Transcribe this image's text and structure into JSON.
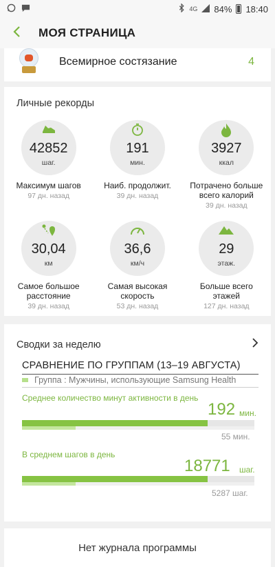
{
  "status": {
    "signal": "4G",
    "battery": "84%",
    "time": "18:40"
  },
  "appbar": {
    "title": "МОЯ СТРАНИЦА"
  },
  "top_item": {
    "label": "Всемирное состязание",
    "count": "4"
  },
  "records": {
    "title": "Личные рекорды",
    "items": [
      {
        "value": "42852",
        "unit": "шаг.",
        "name": "Максимум шагов",
        "ago": "97 дн. назад",
        "icon": "shoe-icon"
      },
      {
        "value": "191",
        "unit": "мин.",
        "name": "Наиб. продолжит.",
        "ago": "39 дн. назад",
        "icon": "stopwatch-icon"
      },
      {
        "value": "3927",
        "unit": "ккал",
        "name": "Потрачено больше всего калорий",
        "ago": "39 дн. назад",
        "icon": "flame-icon"
      },
      {
        "value": "30,04",
        "unit": "км",
        "name": "Самое большое расстояние",
        "ago": "39 дн. назад",
        "icon": "route-pin-icon"
      },
      {
        "value": "36,6",
        "unit": "км/ч",
        "name": "Самая высокая скорость",
        "ago": "53 дн. назад",
        "icon": "speedometer-icon"
      },
      {
        "value": "29",
        "unit": "этаж.",
        "name": "Больше всего этажей",
        "ago": "127 дн. назад",
        "icon": "mountain-icon"
      }
    ]
  },
  "weekly": {
    "title": "Сводки за неделю",
    "compare_title": "СРАВНЕНИЕ ПО ГРУППАМ (13–19 АВГУСТА)",
    "group_label": "Группа : Мужчины, использующие Samsung Health",
    "active_minutes": {
      "label": "Среднее количество минут активности в день",
      "value": "192",
      "unit": "мин.",
      "group_value": "55 мин.",
      "fill": 0.8,
      "group_fill": 0.23
    },
    "steps": {
      "label": "В среднем шагов в день",
      "value": "18771",
      "unit": "шаг.",
      "group_value": "5287 шаг.",
      "fill": 0.8,
      "group_fill": 0.23
    }
  },
  "bottom": {
    "label": "Нет журнала программы"
  },
  "colors": {
    "accent": "#7cb63f",
    "bar": "#86c343",
    "bar_light": "#c4e69e"
  }
}
